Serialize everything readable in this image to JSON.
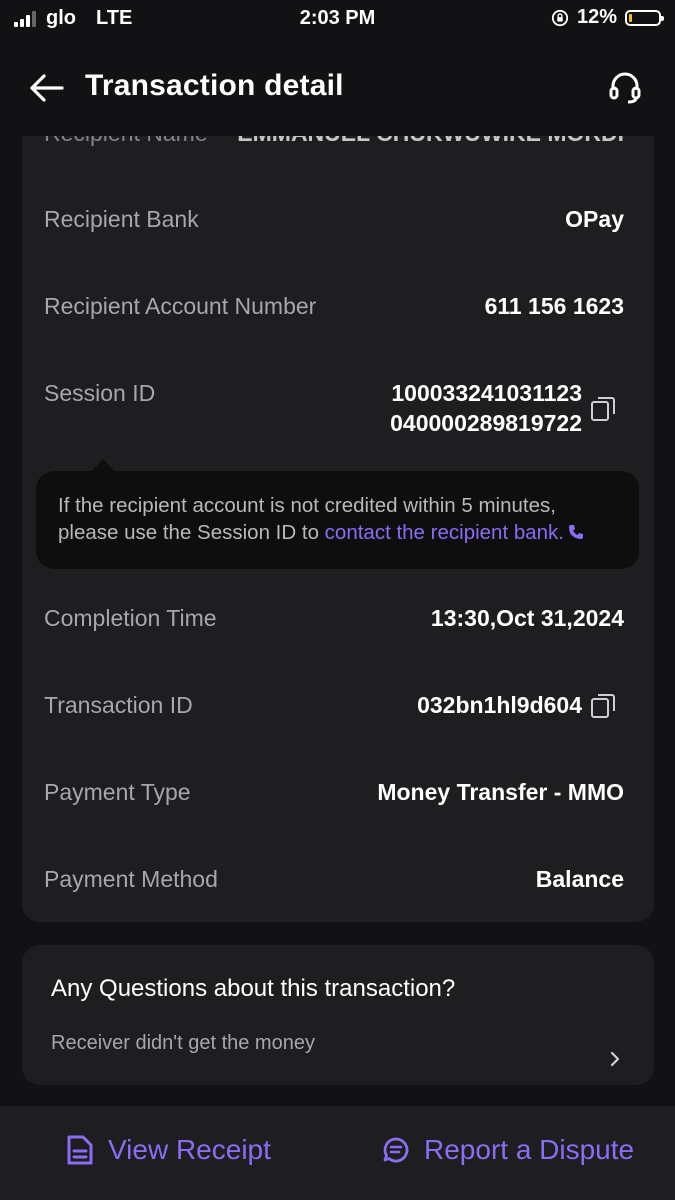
{
  "status_bar": {
    "carrier": "glo",
    "network": "LTE",
    "time": "2:03 PM",
    "battery": "12%",
    "battery_level": 0.12
  },
  "header": {
    "title": "Transaction detail",
    "back_icon": "arrow-left-icon",
    "support_icon": "headset-icon"
  },
  "details": {
    "cut_label": "Recipient Name",
    "cut_value": "EMMANUEL CHUKWUWIKE MORDI",
    "recipient_bank_label": "Recipient Bank",
    "recipient_bank_value": "OPay",
    "account_number_label": "Recipient Account Number",
    "account_number_value": "611 156 1623",
    "session_id_label": "Session ID",
    "session_id_line1": "100033241031123",
    "session_id_line2": "040000289819722",
    "tooltip_line1": "If the recipient account is not credited within 5 minutes,",
    "tooltip_line2": "please use the Session ID to ",
    "tooltip_link": "contact the recipient bank.",
    "completion_time_label": "Completion Time",
    "completion_time_value": "13:30,Oct 31,2024",
    "transaction_id_label": "Transaction ID",
    "transaction_id_value": "032bn1hl9d604",
    "payment_type_label": "Payment Type",
    "payment_type_value": "Money Transfer - MMO",
    "payment_method_label": "Payment Method",
    "payment_method_value": "Balance"
  },
  "questions": {
    "title": "Any Questions about this transaction?",
    "item": "Receiver didn't get the money"
  },
  "bottom": {
    "view_receipt": "View Receipt",
    "report_dispute": "Report a Dispute"
  },
  "colors": {
    "accent": "#8b6cf5",
    "background": "#121214",
    "card": "#1e1e20",
    "battery": "#f5c518"
  }
}
